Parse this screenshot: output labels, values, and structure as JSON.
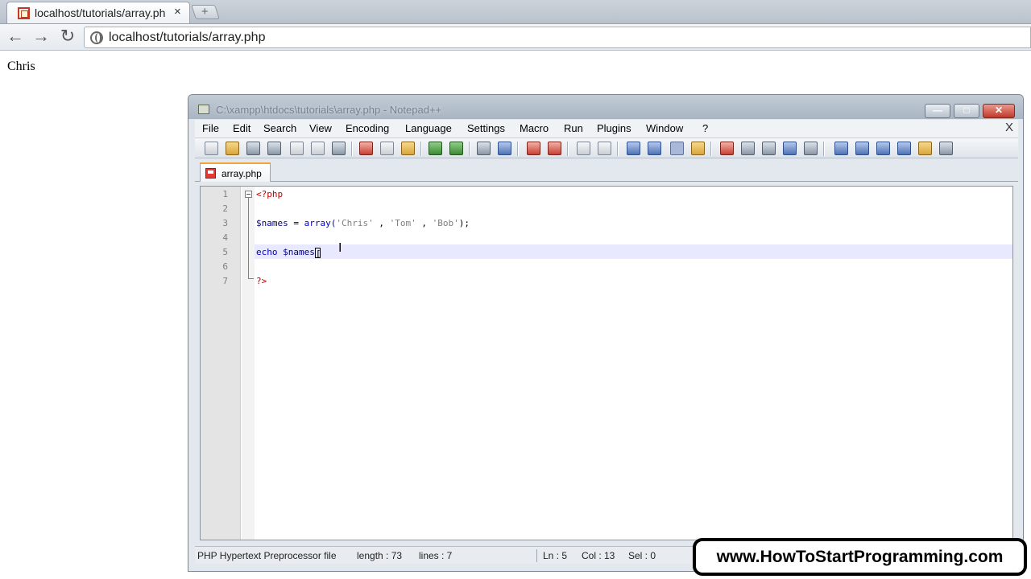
{
  "browser": {
    "tab_title": "localhost/tutorials/array.ph",
    "tab_close": "×",
    "new_tab": "+",
    "back": "←",
    "forward": "→",
    "reload": "↻",
    "url": "localhost/tutorials/array.php"
  },
  "page": {
    "output_text": "Chris"
  },
  "npp": {
    "window_title": "C:\\xampp\\htdocs\\tutorials\\array.php - Notepad++",
    "minimize": "—",
    "maximize": "□",
    "close": "✕",
    "menu": [
      "File",
      "Edit",
      "Search",
      "View",
      "Encoding",
      "Language",
      "Settings",
      "Macro",
      "Run",
      "Plugins",
      "Window",
      "?"
    ],
    "menu_close": "X",
    "doc_tab": "array.php",
    "line_numbers": [
      "1",
      "2",
      "3",
      "4",
      "5",
      "6",
      "7"
    ],
    "code": {
      "line1": "<?php",
      "line3_var": "$names",
      "line3_op": " = ",
      "line3_fn": "array(",
      "line3_s1": "'Chris'",
      "line3_c1": " , ",
      "line3_s2": "'Tom'",
      "line3_c2": " , ",
      "line3_s3": "'Bob'",
      "line3_end": ");",
      "line5_kw": "echo",
      "line5_var": " $names",
      "line5_bracket": "[",
      "line7": "?>"
    },
    "cursor_icon": "I",
    "status": {
      "language": "PHP Hypertext Preprocessor file",
      "length": "length : 73",
      "lines": "lines : 7",
      "ln": "Ln : 5",
      "col": "Col : 13",
      "sel": "Sel : 0"
    }
  },
  "watermark": {
    "text": "www.HowToStartProgramming.com"
  }
}
